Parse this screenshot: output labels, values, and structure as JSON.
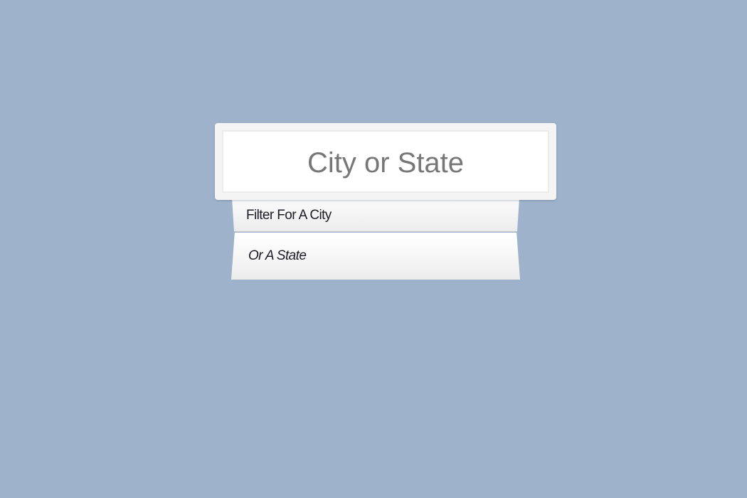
{
  "search": {
    "placeholder": "City or State",
    "value": ""
  },
  "suggestions": [
    {
      "label": "Filter For A City"
    },
    {
      "label": "Or A State"
    }
  ],
  "colors": {
    "background": "#9eb3cb",
    "card": "#f4f4f4",
    "input_background": "#ffffff",
    "placeholder_text": "#777777",
    "suggestion_text": "#1c1c24"
  }
}
